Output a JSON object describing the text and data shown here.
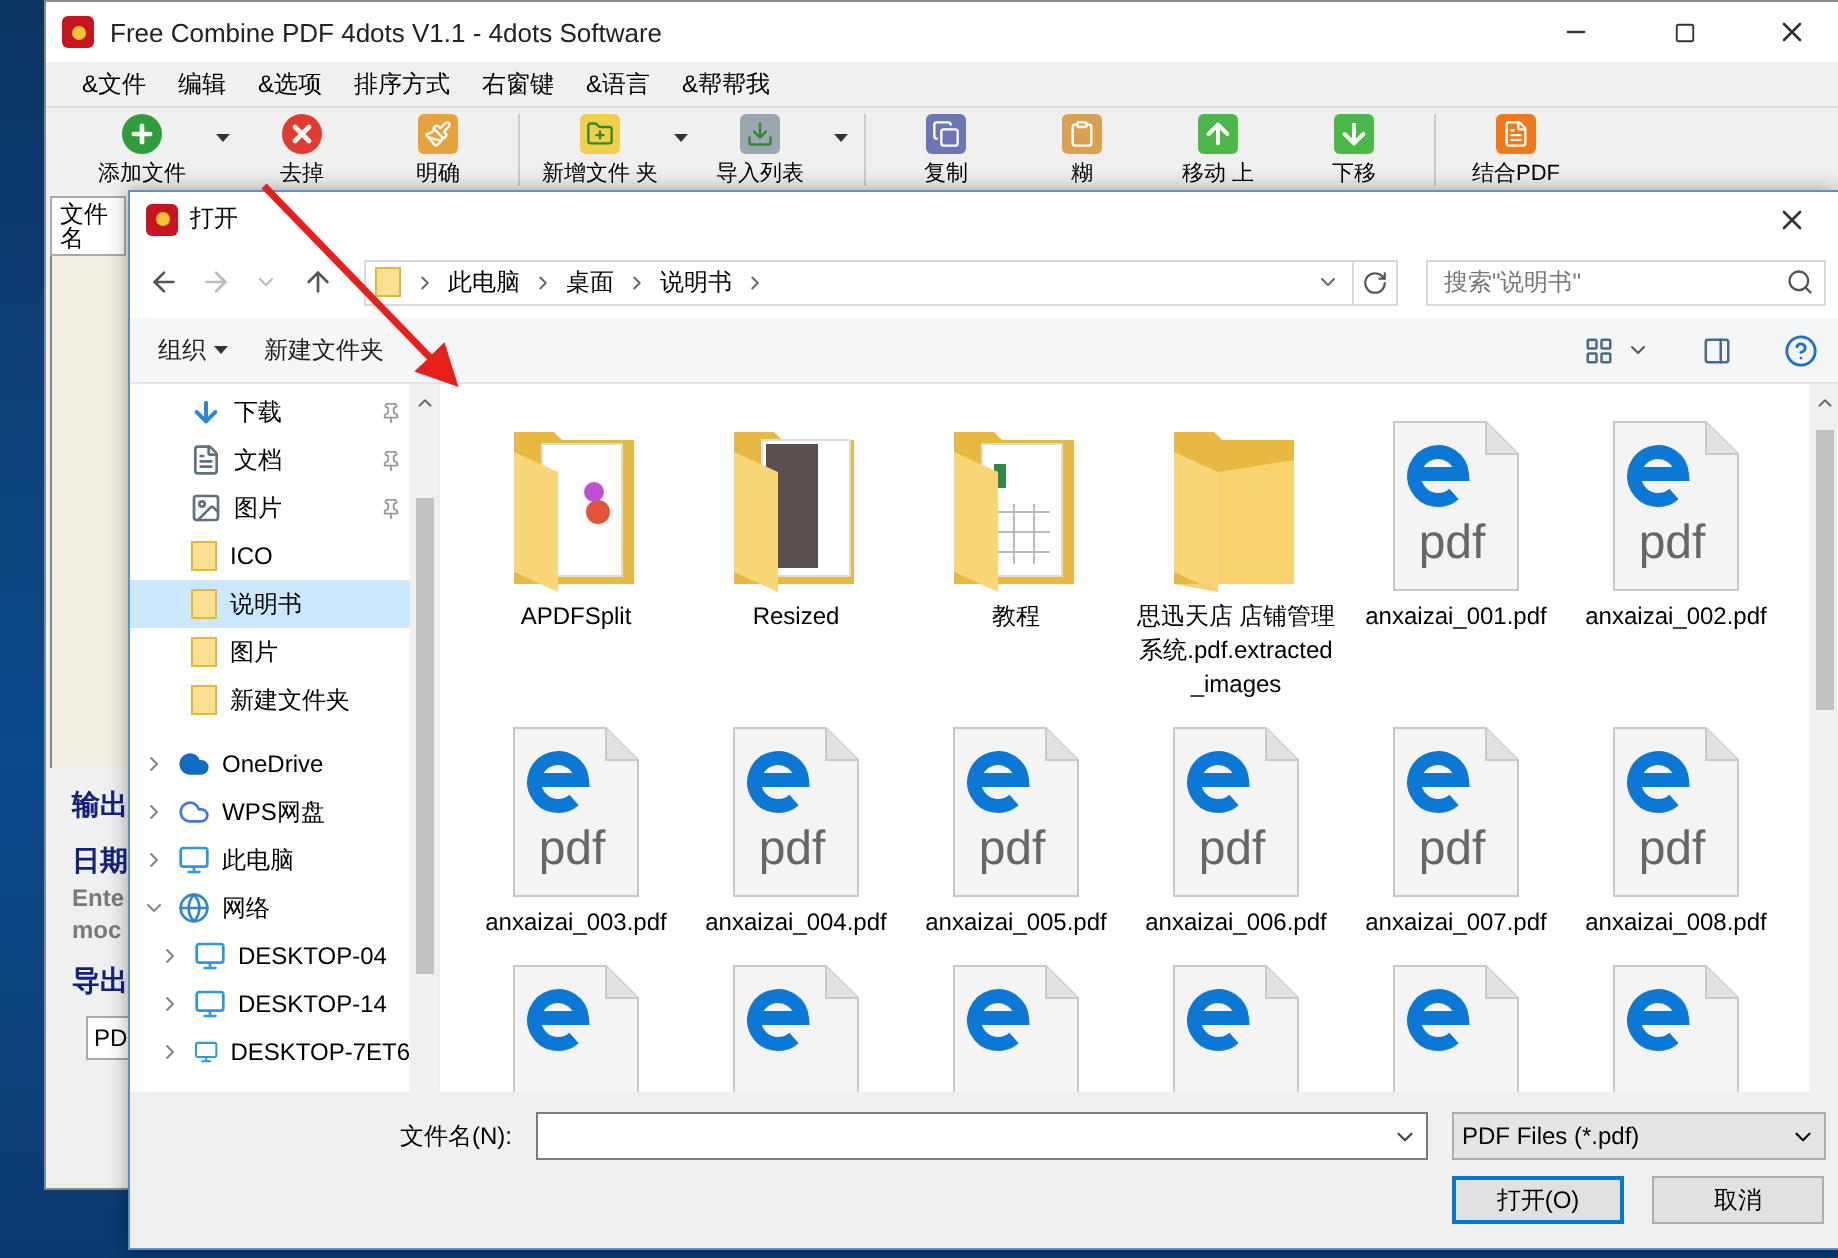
{
  "app_window": {
    "title": "Free Combine PDF 4dots V1.1 - 4dots Software",
    "menu": [
      "&文件",
      "编辑",
      "&选项",
      "排序方式",
      "右窗键",
      "&语言",
      "&帮帮我"
    ],
    "toolbar": [
      {
        "label": "添加文件",
        "kind": "add",
        "dropdown": true
      },
      {
        "label": "去掉",
        "kind": "remove",
        "dropdown": false
      },
      {
        "label": "明确",
        "kind": "clear",
        "dropdown": false
      },
      {
        "label": "新增文件 夹",
        "kind": "add_folder",
        "dropdown": true
      },
      {
        "label": "导入列表",
        "kind": "import",
        "dropdown": true
      },
      {
        "label": "复制",
        "kind": "copy",
        "dropdown": false
      },
      {
        "label": "糊",
        "kind": "paste",
        "dropdown": false
      },
      {
        "label": "移动 上",
        "kind": "up",
        "dropdown": false
      },
      {
        "label": "下移",
        "kind": "down",
        "dropdown": false
      },
      {
        "label": "结合PDF",
        "kind": "combine",
        "dropdown": false
      }
    ],
    "file_list_header": "文件名",
    "side_texts": [
      {
        "text": "输出",
        "kind": "heading"
      },
      {
        "text": "日期",
        "kind": "heading"
      },
      {
        "text": "Ente",
        "kind": "note"
      },
      {
        "text": "moc",
        "kind": "note"
      },
      {
        "text": "导出",
        "kind": "heading"
      }
    ],
    "output_field": "PD"
  },
  "dialog": {
    "title": "打开",
    "breadcrumb": [
      "此电脑",
      "桌面",
      "说明书"
    ],
    "search": {
      "placeholder": "搜索\"说明书\""
    },
    "toolbar": {
      "organize": "组织",
      "new_folder": "新建文件夹"
    },
    "quick_access": [
      {
        "label": "下载",
        "kind": "download",
        "pinned": true,
        "selected": false
      },
      {
        "label": "文档",
        "kind": "document",
        "pinned": true,
        "selected": false
      },
      {
        "label": "图片",
        "kind": "picture",
        "pinned": true,
        "selected": false
      },
      {
        "label": "ICO",
        "kind": "folder",
        "pinned": false,
        "selected": false
      },
      {
        "label": "说明书",
        "kind": "folder",
        "pinned": false,
        "selected": true
      },
      {
        "label": "图片",
        "kind": "folder",
        "pinned": false,
        "selected": false
      },
      {
        "label": "新建文件夹",
        "kind": "folder",
        "pinned": false,
        "selected": false
      }
    ],
    "locations": [
      {
        "label": "OneDrive",
        "kind": "onedrive",
        "expanded": false,
        "selected": false
      },
      {
        "label": "WPS网盘",
        "kind": "cloud",
        "expanded": false,
        "selected": false
      },
      {
        "label": "此电脑",
        "kind": "computer",
        "expanded": false,
        "selected": false
      },
      {
        "label": "网络",
        "kind": "network",
        "expanded": true,
        "selected": false,
        "children": [
          {
            "label": "DESKTOP-04",
            "kind": "computer",
            "expanded": false,
            "selected": false
          },
          {
            "label": "DESKTOP-14",
            "kind": "computer",
            "expanded": false,
            "selected": false
          },
          {
            "label": "DESKTOP-7ET6",
            "kind": "computer",
            "expanded": false,
            "selected": false
          }
        ]
      }
    ],
    "files": [
      {
        "name": "APDFSplit",
        "kind": "document_folder"
      },
      {
        "name": "Resized",
        "kind": "photo_folder"
      },
      {
        "name": "教程",
        "kind": "sheet_folder"
      },
      {
        "name": "思迅天店 店铺管理系统.pdf.extracted_images",
        "kind": "folder"
      },
      {
        "name": "anxaizai_001.pdf",
        "kind": "pdf",
        "badge": "pdf"
      },
      {
        "name": "anxaizai_002.pdf",
        "kind": "pdf",
        "badge": "pdf"
      },
      {
        "name": "anxaizai_003.pdf",
        "kind": "pdf",
        "badge": "pdf"
      },
      {
        "name": "anxaizai_004.pdf",
        "kind": "pdf",
        "badge": "pdf"
      },
      {
        "name": "anxaizai_005.pdf",
        "kind": "pdf",
        "badge": "pdf"
      },
      {
        "name": "anxaizai_006.pdf",
        "kind": "pdf",
        "badge": "pdf"
      },
      {
        "name": "anxaizai_007.pdf",
        "kind": "pdf",
        "badge": "pdf"
      },
      {
        "name": "anxaizai_008.pdf",
        "kind": "pdf",
        "badge": "pdf"
      },
      {
        "kind": "pdf"
      },
      {
        "kind": "pdf"
      },
      {
        "kind": "pdf"
      },
      {
        "kind": "pdf"
      },
      {
        "kind": "pdf"
      },
      {
        "kind": "pdf"
      }
    ],
    "filename_label": "文件名(N):",
    "filter": "PDF Files (*.pdf)",
    "buttons": [
      {
        "label": "打开(O)",
        "default": true
      },
      {
        "label": "取消",
        "default": false
      }
    ]
  }
}
